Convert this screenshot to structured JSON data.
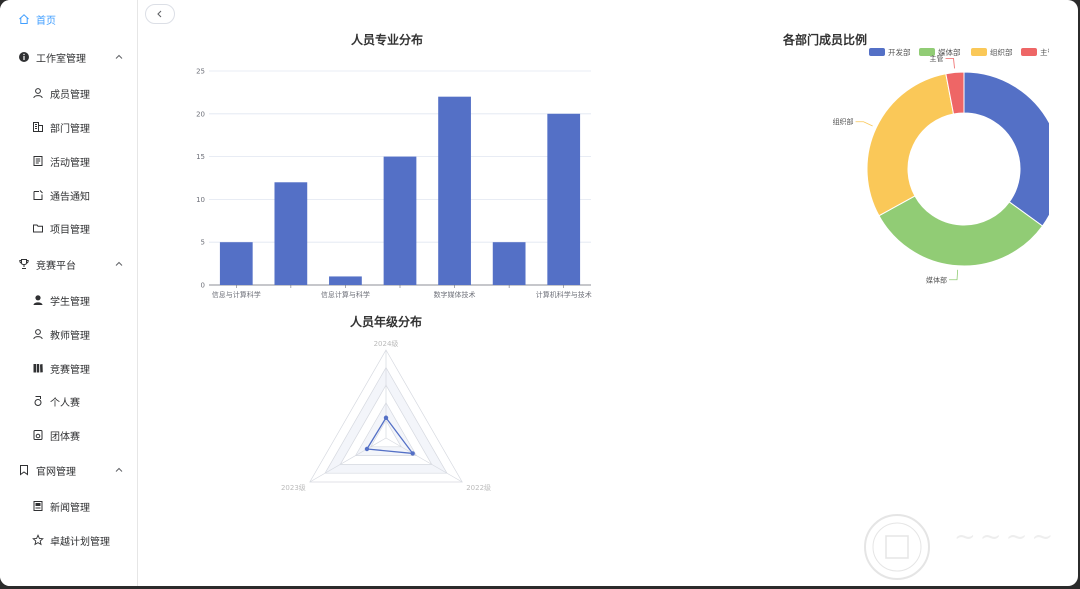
{
  "sidebar": {
    "items": [
      {
        "label": "首页",
        "icon": "home-icon",
        "active": true
      },
      {
        "label": "工作室管理",
        "icon": "info-icon",
        "group": true
      },
      {
        "label": "成员管理",
        "icon": "user-icon"
      },
      {
        "label": "部门管理",
        "icon": "building-icon"
      },
      {
        "label": "活动管理",
        "icon": "document-icon"
      },
      {
        "label": "通告通知",
        "icon": "notice-icon"
      },
      {
        "label": "项目管理",
        "icon": "folder-icon"
      },
      {
        "label": "竞赛平台",
        "icon": "trophy-icon",
        "group": true
      },
      {
        "label": "学生管理",
        "icon": "user-filled-icon"
      },
      {
        "label": "教师管理",
        "icon": "user-icon"
      },
      {
        "label": "竞赛管理",
        "icon": "books-icon"
      },
      {
        "label": "个人赛",
        "icon": "medal-icon"
      },
      {
        "label": "团体赛",
        "icon": "medal-box-icon"
      },
      {
        "label": "官网管理",
        "icon": "bookmark-icon",
        "group": true
      },
      {
        "label": "新闻管理",
        "icon": "news-icon"
      },
      {
        "label": "卓越计划管理",
        "icon": "star-icon"
      }
    ]
  },
  "chart_data": [
    {
      "type": "bar",
      "title": "人员专业分布",
      "categories": [
        "信息与计算科学",
        "",
        "信息计算与科学",
        "",
        "数字媒体技术",
        "",
        "计算机科学与技术"
      ],
      "values": [
        5,
        12,
        1,
        15,
        22,
        5,
        20
      ],
      "ylim": [
        0,
        25
      ],
      "yticks": [
        0,
        5,
        10,
        15,
        20,
        25
      ],
      "color": "#5470c6"
    },
    {
      "type": "pie",
      "title": "各部门成员比例",
      "legend_position": "top",
      "slices": [
        {
          "name": "开发部",
          "value": 35,
          "color": "#5470c6"
        },
        {
          "name": "媒体部",
          "value": 32,
          "color": "#91cc75"
        },
        {
          "name": "组织部",
          "value": 30,
          "color": "#fac858"
        },
        {
          "name": "主管",
          "value": 3,
          "color": "#ee6666"
        }
      ]
    },
    {
      "type": "radar",
      "title": "人员年级分布",
      "indicators": [
        "2024级",
        "2022级",
        "2023级"
      ],
      "values": [
        0.23,
        0.35,
        0.25
      ],
      "max": 1,
      "color": "#5470c6"
    }
  ]
}
